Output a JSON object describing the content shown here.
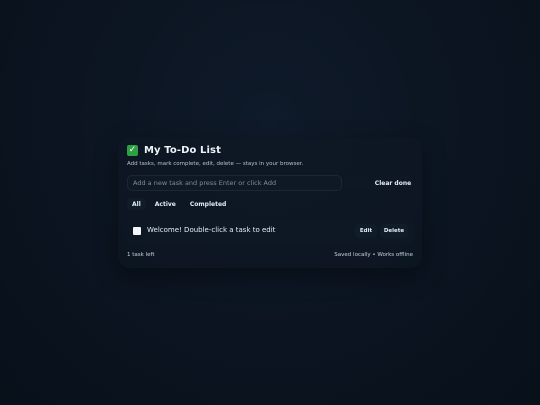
{
  "app": {
    "title": "My To-Do List",
    "subtitle": "Add tasks, mark complete, edit, delete — stays in your browser.",
    "title_icon": "check-mark-button-icon"
  },
  "new_task": {
    "placeholder": "Add a new task and press Enter or click Add",
    "value": ""
  },
  "toolbar": {
    "add_label": "",
    "clear_done_label": "Clear done"
  },
  "filters": {
    "items": [
      {
        "label": "All"
      },
      {
        "label": "Active"
      },
      {
        "label": "Completed"
      }
    ],
    "selected": "All"
  },
  "tasks": [
    {
      "text": "Welcome! Double-click a task to edit",
      "completed": false,
      "edit_label": "Edit",
      "delete_label": "Delete"
    }
  ],
  "footer": {
    "tasks_left": "1 task left",
    "note": "Saved locally • Works offline"
  },
  "colors": {
    "background": "#0b1420",
    "card": "#0e1724",
    "accent_check": "#2ea043",
    "text": "#e6edf5"
  }
}
